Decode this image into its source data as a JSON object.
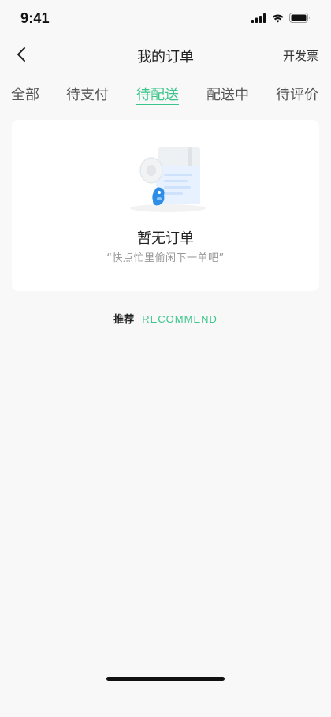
{
  "status_bar": {
    "time": "9:41",
    "icons": [
      "cellular-signal-icon",
      "wifi-icon",
      "battery-icon"
    ]
  },
  "nav": {
    "back_icon": "chevron-left-icon",
    "title": "我的订单",
    "right_action": "开发票"
  },
  "tabs": [
    {
      "label": "全部",
      "active": false
    },
    {
      "label": "待支付",
      "active": false
    },
    {
      "label": "待配送",
      "active": true
    },
    {
      "label": "配送中",
      "active": false
    },
    {
      "label": "待评价",
      "active": false
    }
  ],
  "empty_state": {
    "illustration": "empty-orders-illustration",
    "title": "暂无订单",
    "subtitle": "“快点忙里偷闲下一单吧”"
  },
  "recommend": {
    "label_cn": "推荐",
    "label_en": "RECOMMEND"
  },
  "colors": {
    "accent": "#3cc58b",
    "background": "#f8f8f8",
    "card": "#ffffff"
  }
}
